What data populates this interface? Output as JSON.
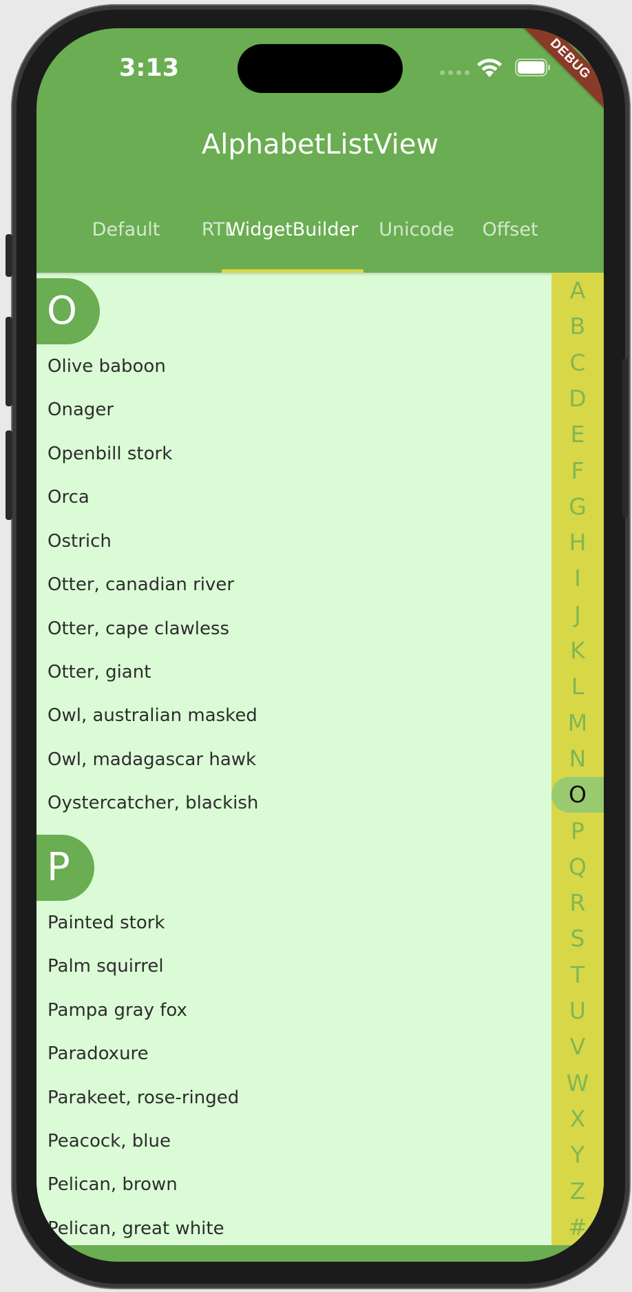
{
  "status_bar": {
    "time": "3:13",
    "debug_label": "DEBUG"
  },
  "app_bar": {
    "title": "AlphabetListView"
  },
  "tabs": [
    {
      "label": "Default",
      "active": false
    },
    {
      "label": "RTL",
      "active": false
    },
    {
      "label": "WidgetBuilder",
      "active": true
    },
    {
      "label": "Unicode",
      "active": false
    },
    {
      "label": "Offset",
      "active": false
    }
  ],
  "sections": [
    {
      "letter": "O",
      "items": [
        "Olive baboon",
        "Onager",
        "Openbill stork",
        "Orca",
        "Ostrich",
        "Otter, canadian river",
        "Otter, cape clawless",
        "Otter, giant",
        "Owl, australian masked",
        "Owl, madagascar hawk",
        "Oystercatcher, blackish"
      ]
    },
    {
      "letter": "P",
      "items": [
        "Painted stork",
        "Palm squirrel",
        "Pampa gray fox",
        "Paradoxure",
        "Parakeet, rose-ringed",
        "Peacock, blue",
        "Pelican, brown",
        "Pelican, great white"
      ]
    }
  ],
  "index_bar": {
    "letters": [
      "A",
      "B",
      "C",
      "D",
      "E",
      "F",
      "G",
      "H",
      "I",
      "J",
      "K",
      "L",
      "M",
      "N",
      "O",
      "P",
      "Q",
      "R",
      "S",
      "T",
      "U",
      "V",
      "W",
      "X",
      "Y",
      "Z",
      "#"
    ],
    "selected": "O"
  },
  "colors": {
    "primary_green": "#6aad52",
    "list_background": "#dbfbd6",
    "index_bar_yellow": "#d8d748",
    "index_letter_green": "#80b754",
    "selected_index_bg": "#9aca70",
    "debug_banner": "#8a3b27"
  }
}
